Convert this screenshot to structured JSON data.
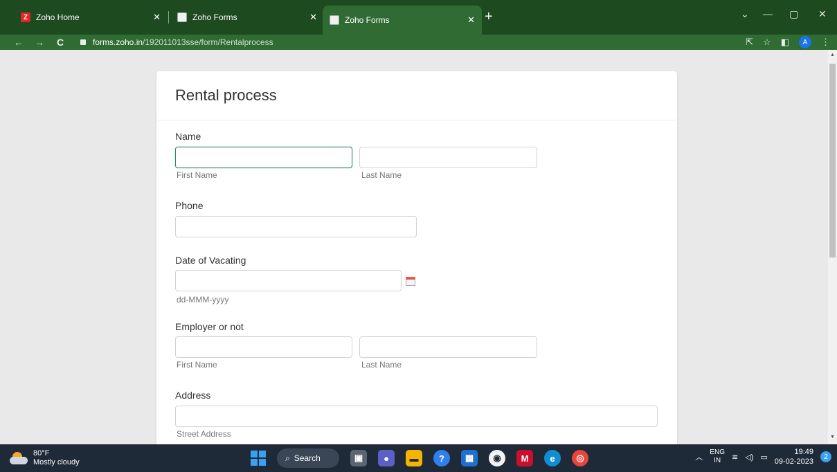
{
  "browser": {
    "tabs": [
      {
        "title": "Zoho Home",
        "favicon": "Z"
      },
      {
        "title": "Zoho Forms",
        "favicon": ""
      },
      {
        "title": "Zoho Forms",
        "favicon": ""
      }
    ],
    "url_host": "forms.zoho.in",
    "url_path": "/192011013sse/form/Rentalprocess",
    "profile_initial": "A",
    "accent": "#2f6b32"
  },
  "form": {
    "title": "Rental process",
    "name_label": "Name",
    "first_name_hint": "First Name",
    "last_name_hint": "Last Name",
    "phone_label": "Phone",
    "date_label": "Date of Vacating",
    "date_hint": "dd-MMM-yyyy",
    "employer_label": "Employer or not",
    "employer_first_hint": "First Name",
    "employer_last_hint": "Last Name",
    "address_label": "Address",
    "street_hint": "Street Address"
  },
  "taskbar": {
    "temperature": "80°F",
    "weather": "Mostly cloudy",
    "search_label": "Search",
    "lang_top": "ENG",
    "lang_bottom": "IN",
    "time": "19:49",
    "date": "09-02-2023",
    "notifications": "2"
  }
}
